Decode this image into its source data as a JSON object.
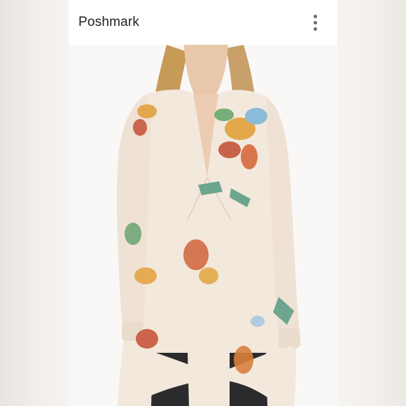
{
  "app": {
    "title": "Poshmark"
  },
  "header": {
    "menu_icon": "more-vert-icon"
  },
  "photo": {
    "subject": "floral-tunic-product-photo"
  },
  "colors": {
    "header_bg": "#ffffff",
    "side_bg": "#efebe7",
    "garment": "#f3e8dc",
    "pants": "#2b2b2d"
  }
}
